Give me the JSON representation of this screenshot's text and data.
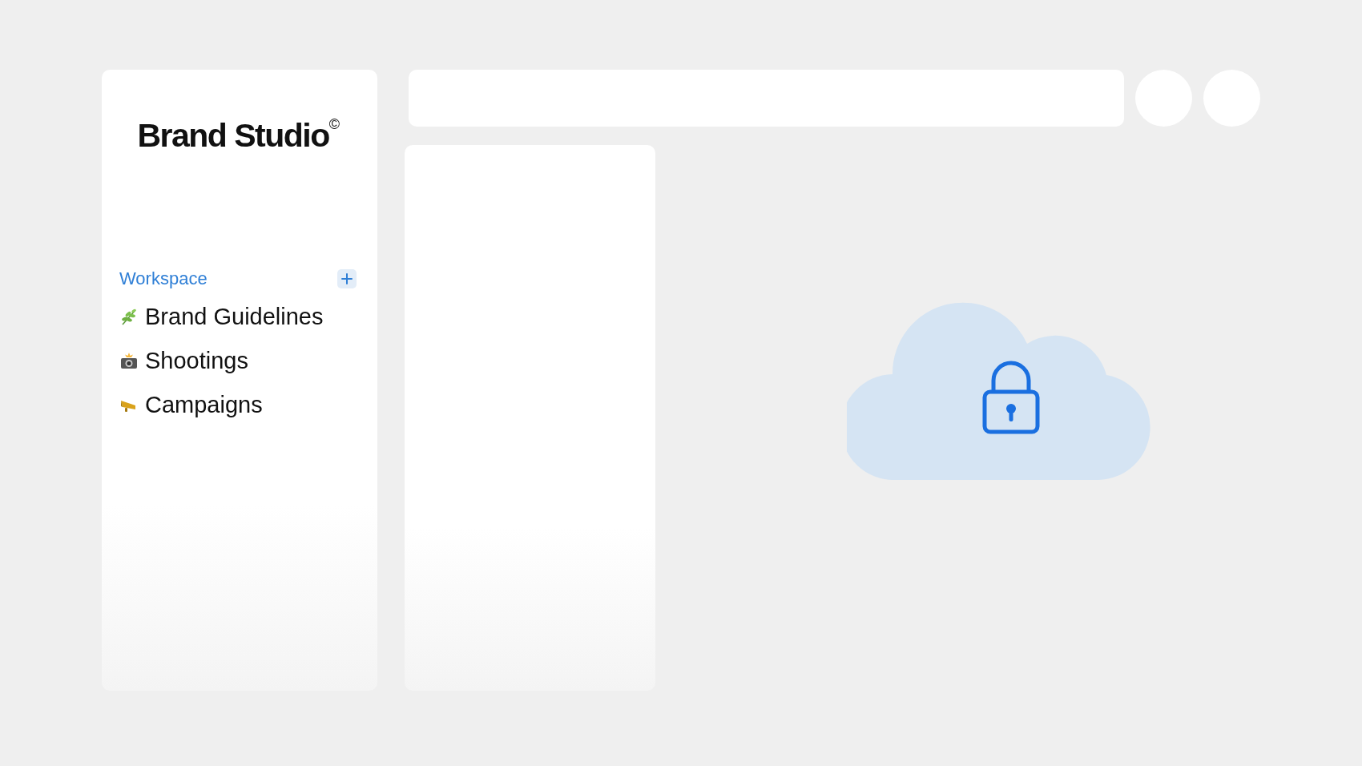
{
  "sidebar": {
    "logo": "Brand Studio$^{©}$",
    "section": {
      "label": "Workspace"
    },
    "items": [
      {
        "kind": "leaf",
        "label": "Brand Guidelines"
      },
      {
        "kind": "camera",
        "label": "Shootings"
      },
      {
        "kind": "megaphone",
        "label": "Campaigns"
      }
    ]
  }
}
